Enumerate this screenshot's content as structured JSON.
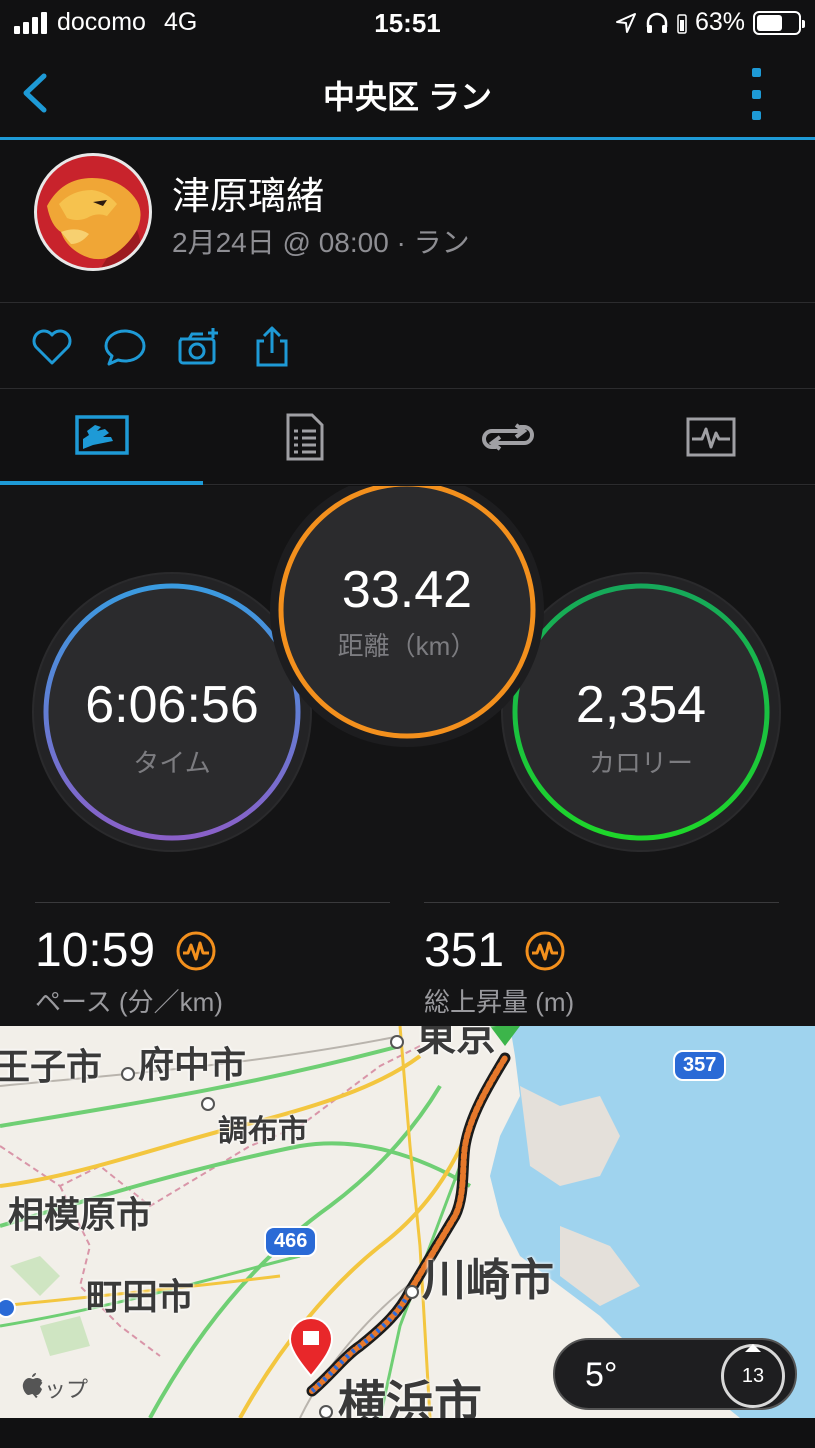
{
  "status_bar": {
    "carrier": "docomo",
    "network": "4G",
    "time": "15:51",
    "battery_percent": "63%",
    "battery_level": 0.63
  },
  "header": {
    "title": "中央区 ラン",
    "back_icon": "chevron-left-icon",
    "menu_icon": "more-vertical-icon"
  },
  "activity": {
    "user_name": "津原璃緒",
    "meta": "2月24日 @ 08:00 · ラン"
  },
  "actions": [
    {
      "icon": "heart-icon"
    },
    {
      "icon": "comment-icon"
    },
    {
      "icon": "add-photo-icon"
    },
    {
      "icon": "share-icon"
    }
  ],
  "tabs": [
    {
      "icon": "overview-icon",
      "active": true
    },
    {
      "icon": "details-list-icon",
      "active": false
    },
    {
      "icon": "laps-icon",
      "active": false
    },
    {
      "icon": "charts-icon",
      "active": false
    }
  ],
  "stats": {
    "time": {
      "value": "6:06:56",
      "label": "タイム"
    },
    "distance": {
      "value": "33.42",
      "label": "距離（km）"
    },
    "calories": {
      "value": "2,354",
      "label": "カロリー"
    },
    "pace": {
      "value": "10:59",
      "label": "ペース (分／km)"
    },
    "elevation": {
      "value": "351",
      "label": "総上昇量 (m)"
    }
  },
  "colors": {
    "accent": "#1e9ad6",
    "distance_ring": "#f3901d",
    "calories_ring": "#1ed72a",
    "time_ring_top": "#3a9be0",
    "time_ring_bottom": "#8a60c8",
    "route_start": "#3cb54a",
    "route_end": "#e8272a"
  },
  "map": {
    "labels": {
      "hachioji": "王子市",
      "fuchu": "府中市",
      "chofu": "調布市",
      "sagamihara": "相模原市",
      "machida": "町田市",
      "kawasaki": "川崎市",
      "yokohama": "横浜市",
      "tokyo": "東京"
    },
    "route_badges": {
      "r466": "466",
      "r357": "357"
    },
    "attribution": "マップ",
    "weather": {
      "temperature": "5°",
      "wind": "13"
    }
  }
}
